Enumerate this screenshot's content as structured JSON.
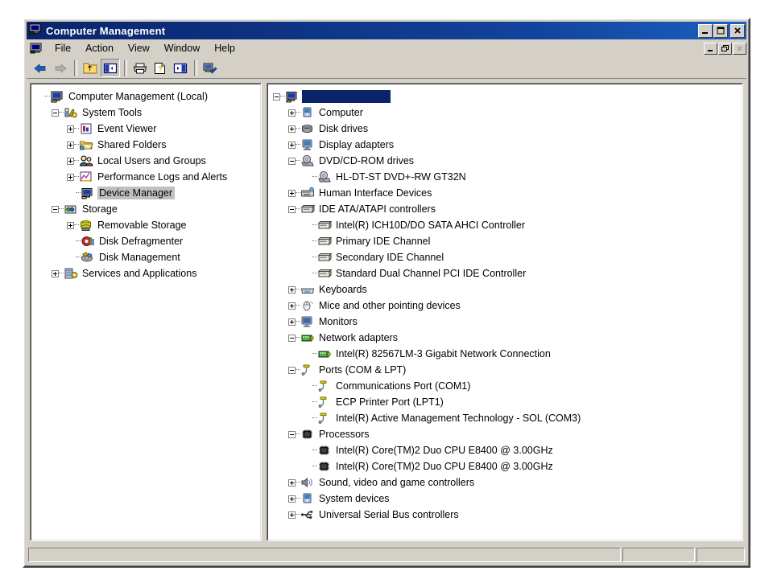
{
  "window": {
    "title": "Computer Management",
    "title_icon": "computer-management-icon",
    "controls": {
      "minimize": "_",
      "maximize": "□",
      "close": "✕"
    },
    "mdi_controls": {
      "minimize": "_",
      "restore": "❐",
      "close": "✕"
    }
  },
  "menubar": {
    "icon": "console-icon",
    "items": [
      {
        "label": "File",
        "name": "menu-file"
      },
      {
        "label": "Action",
        "name": "menu-action"
      },
      {
        "label": "View",
        "name": "menu-view"
      },
      {
        "label": "Window",
        "name": "menu-window"
      },
      {
        "label": "Help",
        "name": "menu-help"
      }
    ]
  },
  "toolbar": {
    "buttons": [
      {
        "name": "back-button",
        "icon": "arrow-left-icon",
        "enabled": true,
        "pressed": false
      },
      {
        "name": "forward-button",
        "icon": "arrow-right-icon",
        "enabled": false,
        "pressed": false
      },
      {
        "name": "up-one-level-button",
        "icon": "folder-up-icon",
        "enabled": true,
        "pressed": false
      },
      {
        "name": "show-hide-console-tree-button",
        "icon": "show-tree-icon",
        "enabled": true,
        "pressed": true
      },
      {
        "name": "print-button",
        "icon": "printer-icon",
        "enabled": true,
        "pressed": false
      },
      {
        "name": "help-button",
        "icon": "help-document-icon",
        "enabled": true,
        "pressed": false
      },
      {
        "name": "properties-button",
        "icon": "pane-icon",
        "enabled": true,
        "pressed": false
      },
      {
        "name": "scan-hardware-changes-button",
        "icon": "scan-tools-icon",
        "enabled": true,
        "pressed": false
      }
    ]
  },
  "console_tree": {
    "items": [
      {
        "label": "Computer Management (Local)",
        "depth": 0,
        "expander": "none",
        "icon": "computer-icon",
        "selected": false,
        "name": "tree-item-computer-management-local"
      },
      {
        "label": "System Tools",
        "depth": 1,
        "expander": "minus",
        "icon": "system-tools-icon",
        "selected": false,
        "name": "tree-item-system-tools"
      },
      {
        "label": "Event Viewer",
        "depth": 2,
        "expander": "plus",
        "icon": "event-viewer-icon",
        "selected": false,
        "name": "tree-item-event-viewer"
      },
      {
        "label": "Shared Folders",
        "depth": 2,
        "expander": "plus",
        "icon": "shared-folders-icon",
        "selected": false,
        "name": "tree-item-shared-folders"
      },
      {
        "label": "Local Users and Groups",
        "depth": 2,
        "expander": "plus",
        "icon": "local-users-icon",
        "selected": false,
        "name": "tree-item-local-users-and-groups"
      },
      {
        "label": "Performance Logs and Alerts",
        "depth": 2,
        "expander": "plus",
        "icon": "performance-logs-icon",
        "selected": false,
        "name": "tree-item-performance-logs-and-alerts"
      },
      {
        "label": "Device Manager",
        "depth": 2,
        "expander": "none",
        "icon": "device-manager-icon",
        "selected": true,
        "name": "tree-item-device-manager"
      },
      {
        "label": "Storage",
        "depth": 1,
        "expander": "minus",
        "icon": "storage-icon",
        "selected": false,
        "name": "tree-item-storage"
      },
      {
        "label": "Removable Storage",
        "depth": 2,
        "expander": "plus",
        "icon": "removable-storage-icon",
        "selected": false,
        "name": "tree-item-removable-storage"
      },
      {
        "label": "Disk Defragmenter",
        "depth": 2,
        "expander": "none",
        "icon": "disk-defragmenter-icon",
        "selected": false,
        "name": "tree-item-disk-defragmenter"
      },
      {
        "label": "Disk Management",
        "depth": 2,
        "expander": "none",
        "icon": "disk-management-icon",
        "selected": false,
        "name": "tree-item-disk-management"
      },
      {
        "label": "Services and Applications",
        "depth": 1,
        "expander": "plus",
        "icon": "services-apps-icon",
        "selected": false,
        "name": "tree-item-services-and-applications"
      }
    ]
  },
  "device_manager_tree": {
    "items": [
      {
        "label": "",
        "depth": 0,
        "expander": "minus",
        "icon": "computer-node-icon",
        "selected": true,
        "name": "device-tree-root-computer-name"
      },
      {
        "label": "Computer",
        "depth": 1,
        "expander": "plus",
        "icon": "computer-category-icon",
        "selected": false,
        "name": "device-category-computer"
      },
      {
        "label": "Disk drives",
        "depth": 1,
        "expander": "plus",
        "icon": "disk-drive-icon",
        "selected": false,
        "name": "device-category-disk-drives"
      },
      {
        "label": "Display adapters",
        "depth": 1,
        "expander": "plus",
        "icon": "display-adapter-icon",
        "selected": false,
        "name": "device-category-display-adapters"
      },
      {
        "label": "DVD/CD-ROM drives",
        "depth": 1,
        "expander": "minus",
        "icon": "dvd-drive-icon",
        "selected": false,
        "name": "device-category-dvd-cd-rom-drives"
      },
      {
        "label": "HL-DT-ST DVD+-RW GT32N",
        "depth": 2,
        "expander": "none",
        "icon": "dvd-drive-icon",
        "selected": false,
        "name": "device-item-hl-dt-st-dvd-rw-gt32n"
      },
      {
        "label": "Human Interface Devices",
        "depth": 1,
        "expander": "plus",
        "icon": "hid-icon",
        "selected": false,
        "name": "device-category-human-interface-devices"
      },
      {
        "label": "IDE ATA/ATAPI controllers",
        "depth": 1,
        "expander": "minus",
        "icon": "ide-controller-icon",
        "selected": false,
        "name": "device-category-ide-ata-atapi-controllers"
      },
      {
        "label": "Intel(R) ICH10D/DO SATA AHCI Controller",
        "depth": 2,
        "expander": "none",
        "icon": "ide-controller-icon",
        "selected": false,
        "name": "device-item-intel-ich10d-do-sata-ahci-controller"
      },
      {
        "label": "Primary IDE Channel",
        "depth": 2,
        "expander": "none",
        "icon": "ide-controller-icon",
        "selected": false,
        "name": "device-item-primary-ide-channel"
      },
      {
        "label": "Secondary IDE Channel",
        "depth": 2,
        "expander": "none",
        "icon": "ide-controller-icon",
        "selected": false,
        "name": "device-item-secondary-ide-channel"
      },
      {
        "label": "Standard Dual Channel PCI IDE Controller",
        "depth": 2,
        "expander": "none",
        "icon": "ide-controller-icon",
        "selected": false,
        "name": "device-item-standard-dual-channel-pci-ide-controller"
      },
      {
        "label": "Keyboards",
        "depth": 1,
        "expander": "plus",
        "icon": "keyboard-icon",
        "selected": false,
        "name": "device-category-keyboards"
      },
      {
        "label": "Mice and other pointing devices",
        "depth": 1,
        "expander": "plus",
        "icon": "mouse-icon",
        "selected": false,
        "name": "device-category-mice-and-other-pointing-devices"
      },
      {
        "label": "Monitors",
        "depth": 1,
        "expander": "plus",
        "icon": "monitor-icon",
        "selected": false,
        "name": "device-category-monitors"
      },
      {
        "label": "Network adapters",
        "depth": 1,
        "expander": "minus",
        "icon": "network-adapter-icon",
        "selected": false,
        "name": "device-category-network-adapters"
      },
      {
        "label": "Intel(R) 82567LM-3 Gigabit Network Connection",
        "depth": 2,
        "expander": "none",
        "icon": "network-adapter-icon",
        "selected": false,
        "name": "device-item-intel-82567lm-3-gigabit-network-connection"
      },
      {
        "label": "Ports (COM & LPT)",
        "depth": 1,
        "expander": "minus",
        "icon": "port-icon",
        "selected": false,
        "name": "device-category-ports-com-lpt"
      },
      {
        "label": "Communications Port (COM1)",
        "depth": 2,
        "expander": "none",
        "icon": "port-icon",
        "selected": false,
        "name": "device-item-communications-port-com1"
      },
      {
        "label": "ECP Printer Port (LPT1)",
        "depth": 2,
        "expander": "none",
        "icon": "port-icon",
        "selected": false,
        "name": "device-item-ecp-printer-port-lpt1"
      },
      {
        "label": "Intel(R) Active Management Technology - SOL (COM3)",
        "depth": 2,
        "expander": "none",
        "icon": "port-icon",
        "selected": false,
        "name": "device-item-intel-amt-sol-com3"
      },
      {
        "label": "Processors",
        "depth": 1,
        "expander": "minus",
        "icon": "processor-icon",
        "selected": false,
        "name": "device-category-processors"
      },
      {
        "label": "Intel(R) Core(TM)2 Duo CPU     E8400  @ 3.00GHz",
        "depth": 2,
        "expander": "none",
        "icon": "processor-icon",
        "selected": false,
        "name": "device-item-processor-0"
      },
      {
        "label": "Intel(R) Core(TM)2 Duo CPU     E8400  @ 3.00GHz",
        "depth": 2,
        "expander": "none",
        "icon": "processor-icon",
        "selected": false,
        "name": "device-item-processor-1"
      },
      {
        "label": "Sound, video and game controllers",
        "depth": 1,
        "expander": "plus",
        "icon": "sound-icon",
        "selected": false,
        "name": "device-category-sound-video-and-game-controllers"
      },
      {
        "label": "System devices",
        "depth": 1,
        "expander": "plus",
        "icon": "system-device-icon",
        "selected": false,
        "name": "device-category-system-devices"
      },
      {
        "label": "Universal Serial Bus controllers",
        "depth": 1,
        "expander": "plus",
        "icon": "usb-icon",
        "selected": false,
        "name": "device-category-universal-serial-bus-controllers"
      }
    ]
  },
  "statusbar": {
    "panes": [
      {
        "text": ""
      },
      {
        "text": ""
      },
      {
        "text": ""
      }
    ]
  },
  "colors": {
    "titlebar_start": "#0a246a",
    "titlebar_end": "#1b5fc0",
    "face": "#d4d0c8",
    "selection_blue": "#0a246a",
    "selection_grey": "#c0c0c0"
  }
}
